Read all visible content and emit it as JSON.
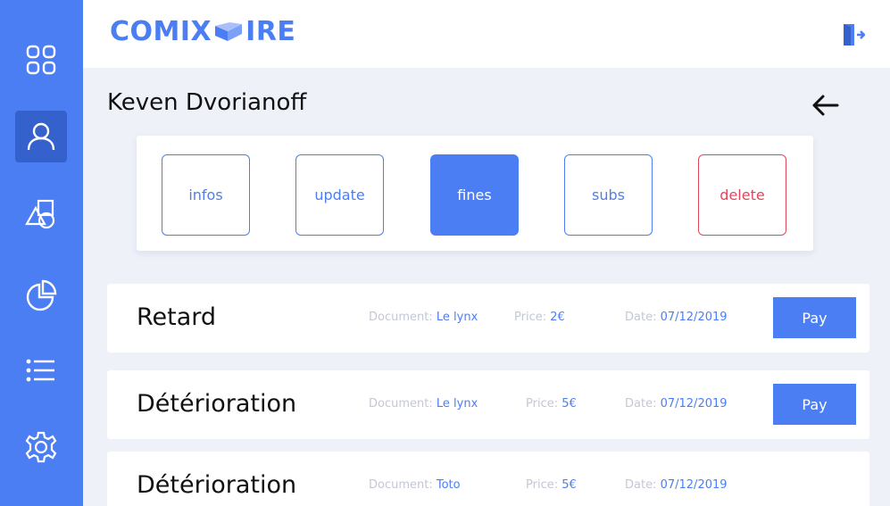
{
  "brand": {
    "logo_left": "COMIX",
    "logo_right": "IRE",
    "accent": "#4c7ef3",
    "danger": "#e0475c"
  },
  "sidebar": {
    "items": [
      {
        "icon": "dashboard-icon",
        "active": false
      },
      {
        "icon": "user-icon",
        "active": true
      },
      {
        "icon": "shapes-icon",
        "active": false
      },
      {
        "icon": "pie-chart-icon",
        "active": false
      },
      {
        "icon": "list-icon",
        "active": false
      },
      {
        "icon": "gear-icon",
        "active": false
      }
    ]
  },
  "header": {
    "logout_icon": "logout-icon"
  },
  "user": {
    "name": "Keven Dvorianoff"
  },
  "actions": {
    "infos": "infos",
    "update": "update",
    "fines": "fines",
    "subs": "subs",
    "delete": "delete",
    "active": "fines"
  },
  "fines": [
    {
      "title": "Retard",
      "document_label": "Document:",
      "document": "Le lynx",
      "price_label": "Price:",
      "price": "2€",
      "date_label": "Date:",
      "date": "07/12/2019",
      "pay_label": "Pay"
    },
    {
      "title": "Détérioration",
      "document_label": "Document:",
      "document": "Le lynx",
      "price_label": "Price:",
      "price": "5€",
      "date_label": "Date:",
      "date": "07/12/2019",
      "pay_label": "Pay"
    },
    {
      "title": "Détérioration",
      "document_label": "Document:",
      "document": "Toto",
      "price_label": "Price:",
      "price": "5€",
      "date_label": "Date:",
      "date": "07/12/2019",
      "pay_label": ""
    }
  ]
}
